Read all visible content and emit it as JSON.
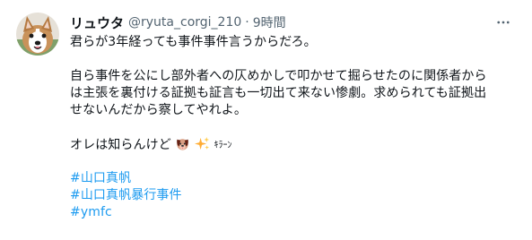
{
  "user": {
    "display_name": "リュウタ",
    "handle": "@ryuta_corgi_210",
    "separator": "·",
    "timestamp": "9時間"
  },
  "tweet": {
    "lines": [
      "君らが3年経っても事件事件言うからだろ。",
      "",
      "自ら事件を公にし部外者への仄めかしで叩かせて掘らせたのに関係者から",
      "は主張を裏付ける証拠も証言も一切出て来ない惨劇。求められても証拠出",
      "せないんだから察してやれよ。",
      ""
    ],
    "last_line_text": "オレは知らんけど",
    "emojis": [
      "dog-face-icon",
      "sparkles-icon"
    ],
    "kira_text": "ｷﾗｰﾝ",
    "hashtags": [
      "#山口真帆",
      "#山口真帆暴行事件",
      "#ymfc"
    ]
  },
  "colors": {
    "text": "#0f1419",
    "muted": "#536471",
    "link": "#1d9bf0"
  }
}
